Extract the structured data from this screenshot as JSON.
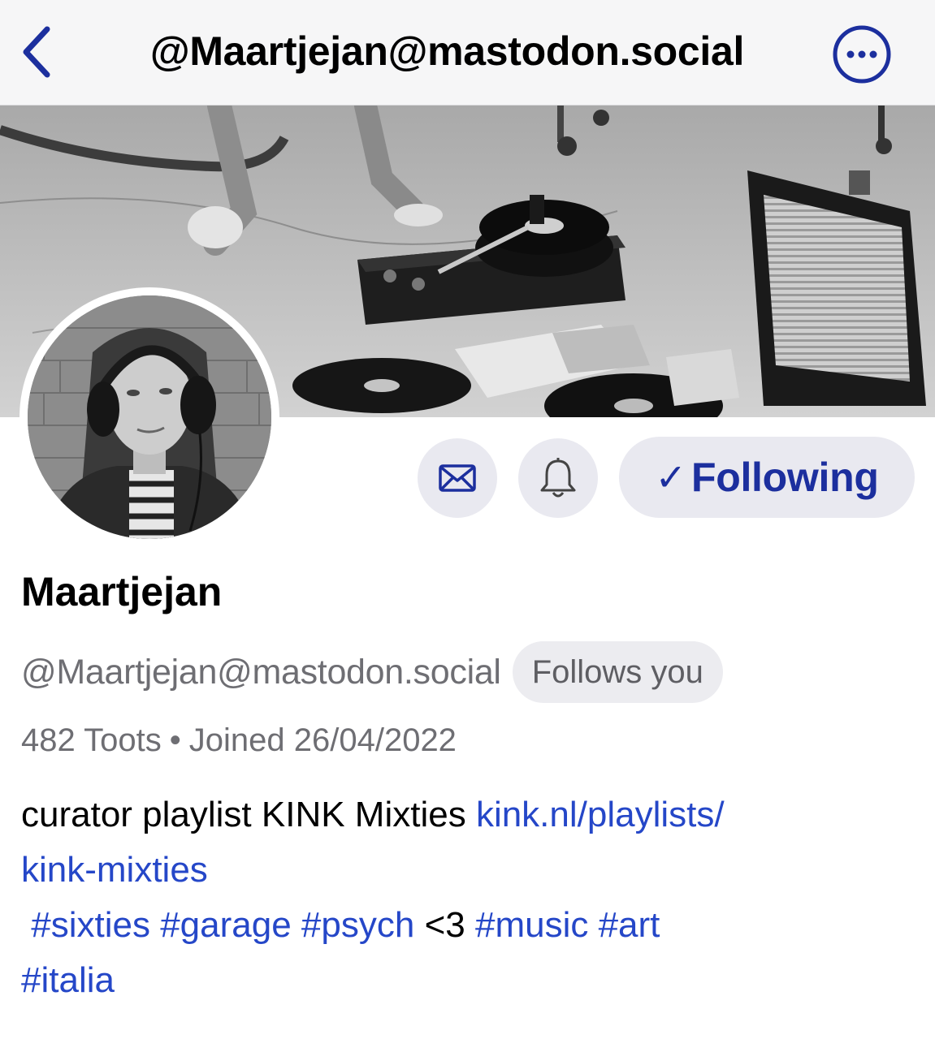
{
  "nav": {
    "title": "@Maartjejan@mastodon.social",
    "back_icon": "chevron-left-icon",
    "more_icon": "ellipsis-circle-icon"
  },
  "colors": {
    "accent": "#1c2f9e",
    "link": "#2547c8",
    "button_bg": "#e9e9f0",
    "secondary_text": "#6e6e73"
  },
  "actions": {
    "mail_icon": "envelope-icon",
    "bell_icon": "bell-icon",
    "following_check": "✓",
    "following_label": "Following"
  },
  "profile": {
    "display_name": "Maartjejan",
    "handle": "@Maartjejan@mastodon.social",
    "follows_badge": "Follows you",
    "toots": "482 Toots",
    "separator": "•",
    "joined": "Joined 26/04/2022"
  },
  "bio": {
    "text_intro": "curator playlist KINK Mixties ",
    "link_part1": "kink.nl/playlists/",
    "link_part2": "kink-mixties",
    "hashtags_a": [
      "#sixties",
      "#garage",
      "#psych"
    ],
    "heart_text": "<3",
    "hashtags_b": [
      "#music",
      "#art"
    ],
    "hashtag_last": "#italia"
  }
}
